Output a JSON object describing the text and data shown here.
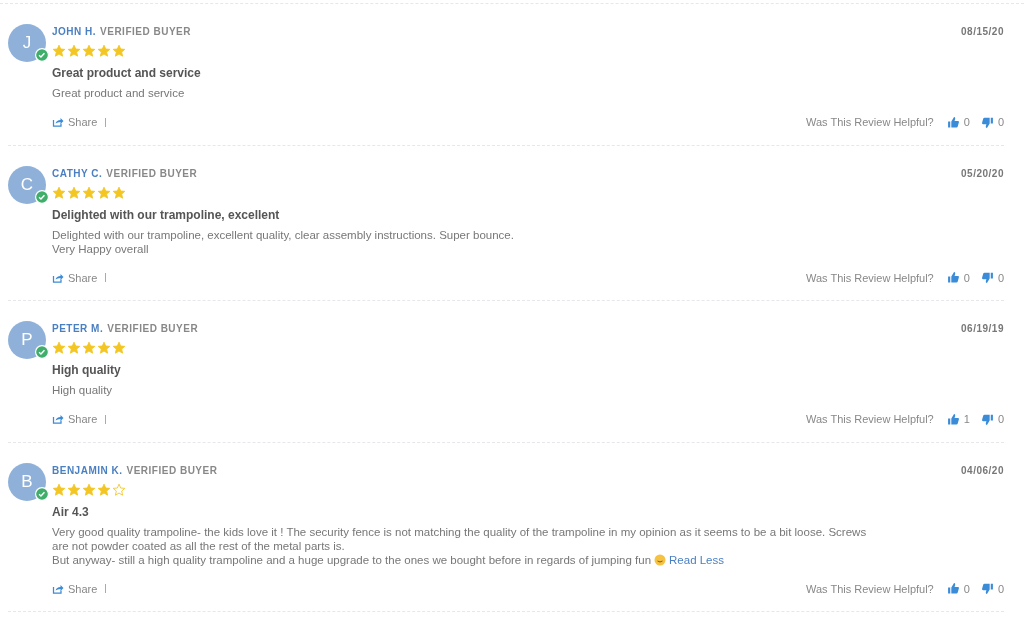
{
  "reviews": [
    {
      "initial": "J",
      "verified": true,
      "name": "JOHN H.",
      "badge": "VERIFIED BUYER",
      "stars": 5,
      "date": "08/15/20",
      "title": "Great product and service",
      "body": [
        "Great product and service"
      ],
      "share": "Share",
      "helpful_label": "Was This Review Helpful?",
      "up": "0",
      "down": "0"
    },
    {
      "initial": "C",
      "verified": true,
      "name": "CATHY C.",
      "badge": "VERIFIED BUYER",
      "stars": 5,
      "date": "05/20/20",
      "title": "Delighted with our trampoline, excellent",
      "body": [
        "Delighted with our trampoline, excellent quality, clear assembly instructions. Super bounce.",
        "Very Happy overall"
      ],
      "share": "Share",
      "helpful_label": "Was This Review Helpful?",
      "up": "0",
      "down": "0"
    },
    {
      "initial": "P",
      "verified": true,
      "name": "PETER M.",
      "badge": "VERIFIED BUYER",
      "stars": 5,
      "date": "06/19/19",
      "title": "High quality",
      "body": [
        "High quality"
      ],
      "share": "Share",
      "helpful_label": "Was This Review Helpful?",
      "up": "1",
      "down": "0"
    },
    {
      "initial": "B",
      "verified": true,
      "name": "BENJAMIN K.",
      "badge": "VERIFIED BUYER",
      "stars": 4,
      "date": "04/06/20",
      "title": "Air 4.3",
      "body": [
        "Very good quality trampoline- the kids love it ! The security fence is not matching the quality of the trampoline in my opinion as it seems to be a bit loose. Screws",
        "are not powder coated as all the rest of the metal parts is.",
        "But anyway- still a high quality trampoline and a huge upgrade to the ones we bought before in regards of jumping fun"
      ],
      "emoji": true,
      "read_less": "Read Less",
      "share": "Share",
      "helpful_label": "Was This Review Helpful?",
      "up": "0",
      "down": "0"
    }
  ]
}
